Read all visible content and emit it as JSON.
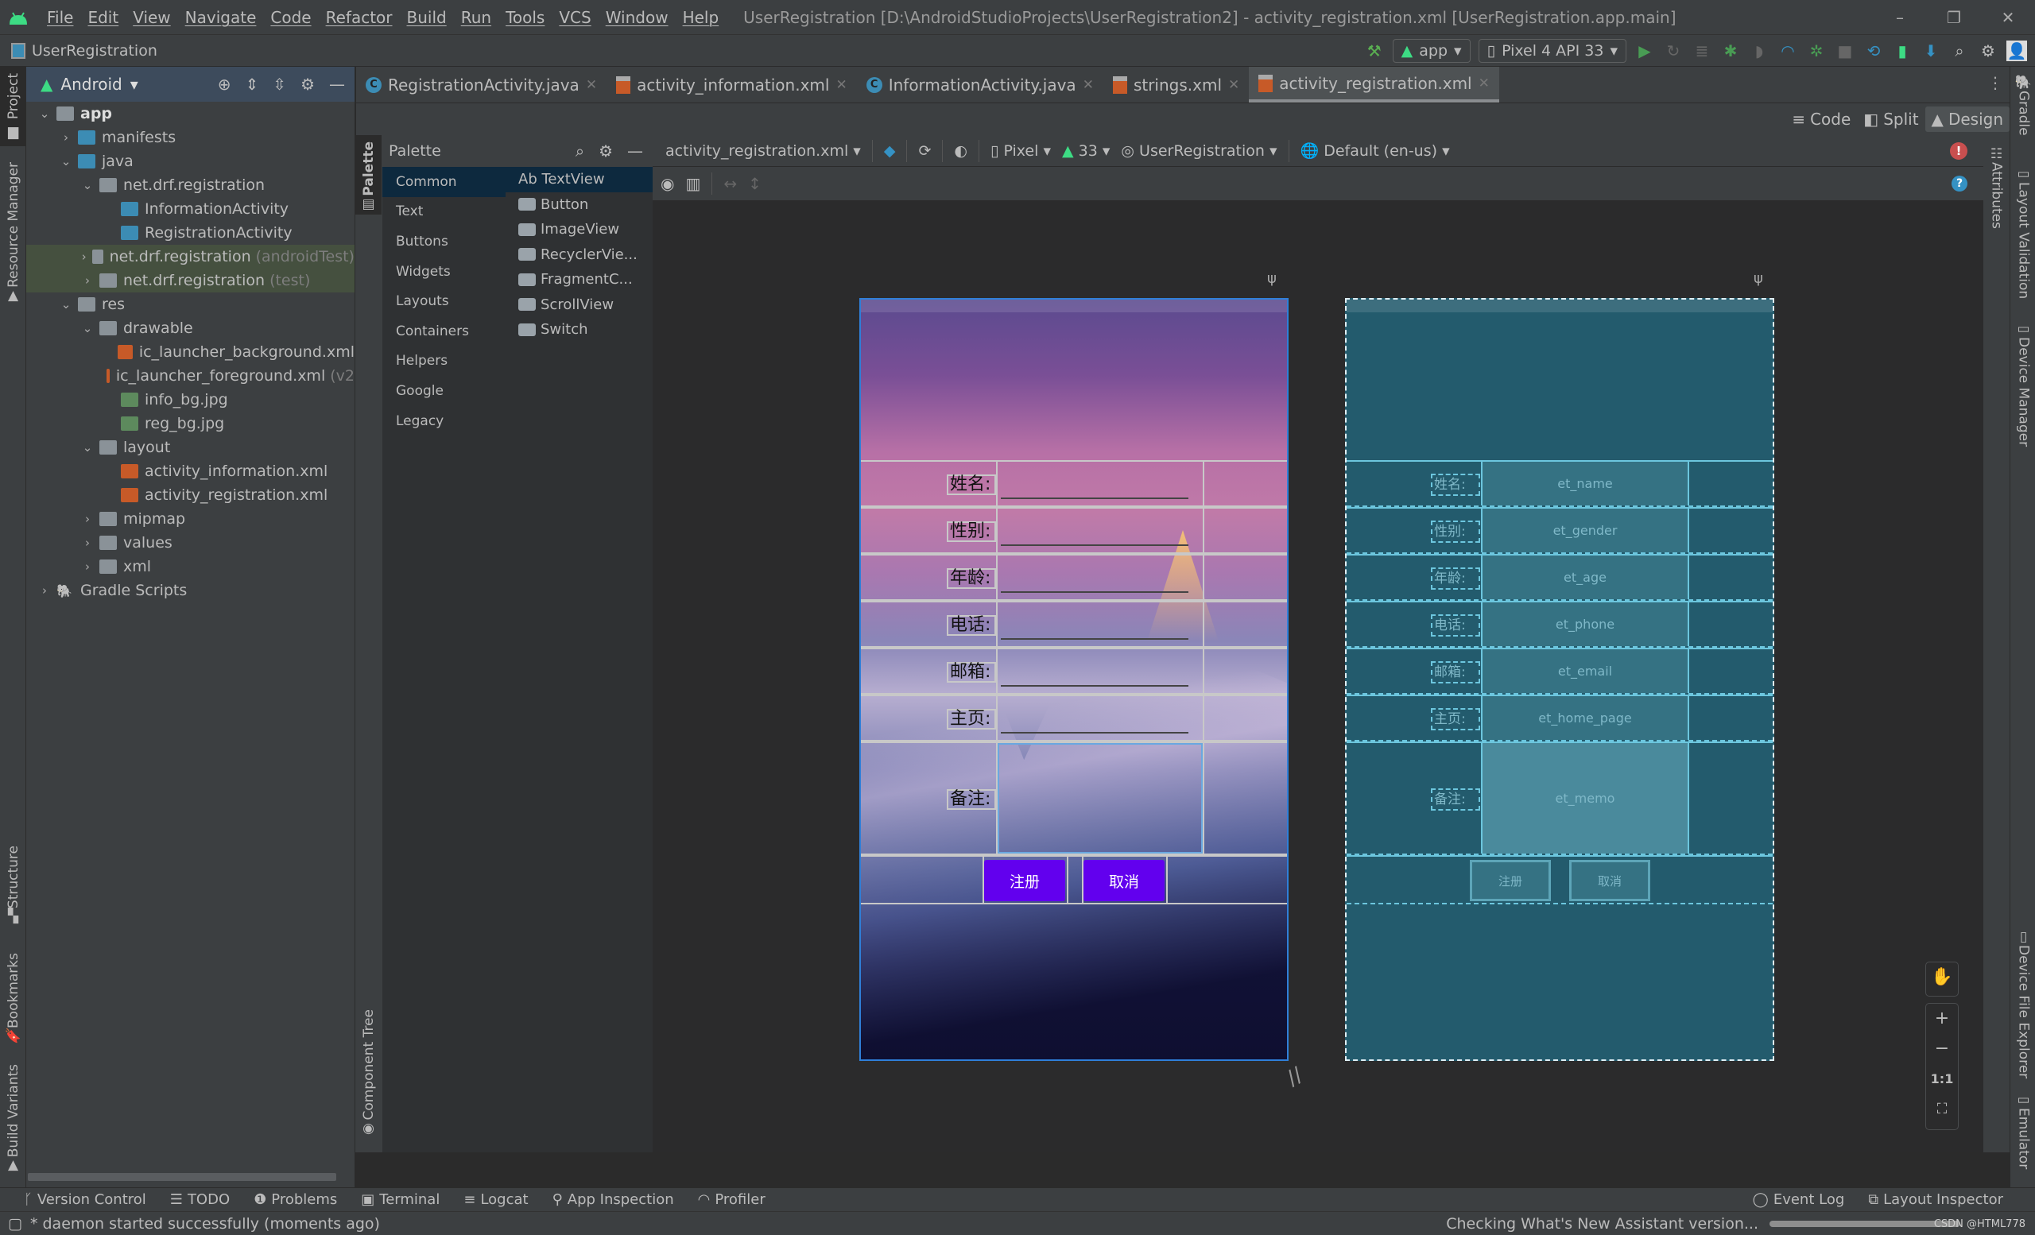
{
  "window": {
    "title": "UserRegistration [D:\\AndroidStudioProjects\\UserRegistration2] - activity_registration.xml [UserRegistration.app.main]",
    "menu": [
      "File",
      "Edit",
      "View",
      "Navigate",
      "Code",
      "Refactor",
      "Build",
      "Run",
      "Tools",
      "VCS",
      "Window",
      "Help"
    ],
    "controls": {
      "minimize": "–",
      "restore": "❐",
      "close": "✕"
    }
  },
  "navbar": {
    "project": "UserRegistration",
    "run_config": "app",
    "device": "Pixel 4 API 33"
  },
  "left_stripe": {
    "tabs": [
      "Project",
      "Resource Manager",
      "Structure",
      "Bookmarks",
      "Build Variants"
    ]
  },
  "right_stripe": {
    "tabs": [
      "Gradle",
      "Layout Validation",
      "Device Manager",
      "Device File Explorer",
      "Emulator"
    ]
  },
  "project_panel": {
    "view_mode": "Android",
    "tree": [
      {
        "label": "app",
        "depth": 0,
        "chev": "v",
        "icon": "module",
        "bold": true
      },
      {
        "label": "manifests",
        "depth": 1,
        "chev": ">",
        "icon": "folder-blue"
      },
      {
        "label": "java",
        "depth": 1,
        "chev": "v",
        "icon": "folder-blue"
      },
      {
        "label": "net.drf.registration",
        "depth": 2,
        "chev": "v",
        "icon": "package"
      },
      {
        "label": "InformationActivity",
        "depth": 3,
        "chev": "",
        "icon": "java"
      },
      {
        "label": "RegistrationActivity",
        "depth": 3,
        "chev": "",
        "icon": "java"
      },
      {
        "label": "net.drf.registration",
        "suffix": "(androidTest)",
        "depth": 2,
        "chev": ">",
        "icon": "package",
        "highlight": true
      },
      {
        "label": "net.drf.registration",
        "suffix": "(test)",
        "depth": 2,
        "chev": ">",
        "icon": "package",
        "highlight": true
      },
      {
        "label": "res",
        "depth": 1,
        "chev": "v",
        "icon": "res"
      },
      {
        "label": "drawable",
        "depth": 2,
        "chev": "v",
        "icon": "package"
      },
      {
        "label": "ic_launcher_background.xml",
        "depth": 3,
        "chev": "",
        "icon": "xml"
      },
      {
        "label": "ic_launcher_foreground.xml",
        "suffix": "(v2",
        "depth": 3,
        "chev": "",
        "icon": "xml"
      },
      {
        "label": "info_bg.jpg",
        "depth": 3,
        "chev": "",
        "icon": "image"
      },
      {
        "label": "reg_bg.jpg",
        "depth": 3,
        "chev": "",
        "icon": "image"
      },
      {
        "label": "layout",
        "depth": 2,
        "chev": "v",
        "icon": "package"
      },
      {
        "label": "activity_information.xml",
        "depth": 3,
        "chev": "",
        "icon": "xml"
      },
      {
        "label": "activity_registration.xml",
        "depth": 3,
        "chev": "",
        "icon": "xml"
      },
      {
        "label": "mipmap",
        "depth": 2,
        "chev": ">",
        "icon": "package"
      },
      {
        "label": "values",
        "depth": 2,
        "chev": ">",
        "icon": "package"
      },
      {
        "label": "xml",
        "depth": 2,
        "chev": ">",
        "icon": "package"
      },
      {
        "label": "Gradle Scripts",
        "depth": 0,
        "chev": ">",
        "icon": "gradle"
      }
    ]
  },
  "editor_tabs": [
    {
      "label": "RegistrationActivity.java",
      "icon": "class"
    },
    {
      "label": "activity_information.xml",
      "icon": "xml"
    },
    {
      "label": "InformationActivity.java",
      "icon": "class"
    },
    {
      "label": "strings.xml",
      "icon": "xml"
    },
    {
      "label": "activity_registration.xml",
      "icon": "xml",
      "active": true
    }
  ],
  "view_modes": {
    "code": "Code",
    "split": "Split",
    "design": "Design",
    "active": "Design"
  },
  "palette": {
    "title": "Palette",
    "stripe_label": "Palette",
    "component_tree_label": "Component Tree",
    "categories": [
      "Common",
      "Text",
      "Buttons",
      "Widgets",
      "Layouts",
      "Containers",
      "Helpers",
      "Google",
      "Legacy"
    ],
    "selected_category": "Common",
    "items": [
      "Ab TextView",
      "Button",
      "ImageView",
      "RecyclerVie...",
      "FragmentC...",
      "ScrollView",
      "Switch"
    ]
  },
  "design_toolbar": {
    "file": "activity_registration.xml",
    "device": "Pixel",
    "api": "33",
    "theme": "UserRegistration",
    "locale": "Default (en-us)"
  },
  "attributes_label": "Attributes",
  "form": {
    "labels": [
      "姓名:",
      "性别:",
      "年龄:",
      "电话:",
      "邮箱:",
      "主页:",
      "备注:"
    ],
    "field_ids": [
      "et_name",
      "et_gender",
      "et_age",
      "et_phone",
      "et_email",
      "et_home_page",
      "et_memo"
    ],
    "buttons": [
      "注册",
      "取消"
    ],
    "button_color": "#6200ee"
  },
  "zoom_controls": {
    "pan": "✋",
    "zoom_in": "+",
    "zoom_out": "−",
    "actual": "1:1",
    "fit": "⛶"
  },
  "bottom_tools": {
    "left": [
      "Version Control",
      "TODO",
      "Problems",
      "Terminal",
      "Logcat",
      "App Inspection",
      "Profiler"
    ],
    "right": [
      "Event Log",
      "Layout Inspector"
    ]
  },
  "status": {
    "message": "* daemon started successfully (moments ago)",
    "progress_text": "Checking What's New Assistant version...",
    "watermark": "CSDN @HTML778"
  }
}
